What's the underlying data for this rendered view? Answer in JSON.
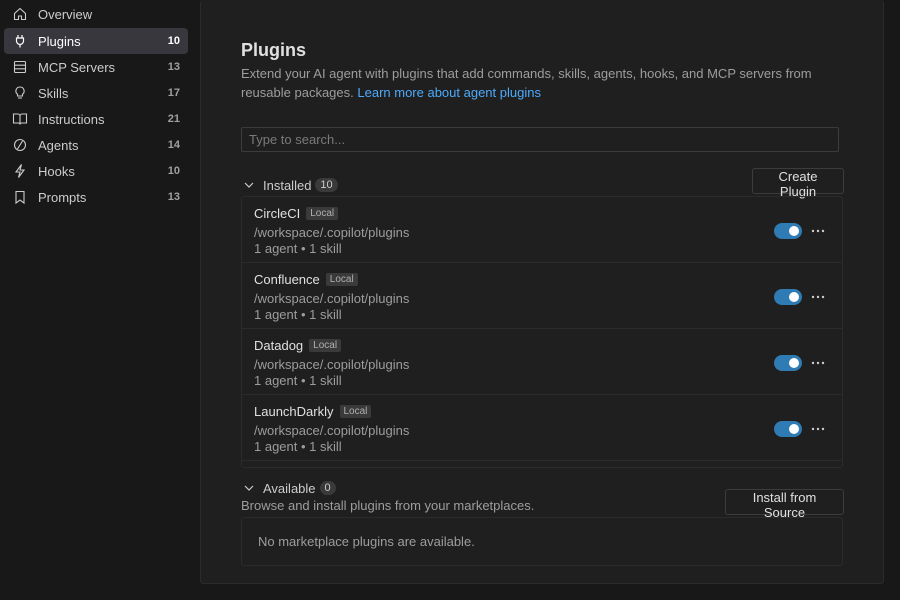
{
  "sidebar": {
    "items": [
      {
        "label": "Overview",
        "count": "",
        "icon": "home-icon"
      },
      {
        "label": "Plugins",
        "count": "10",
        "icon": "plug-icon"
      },
      {
        "label": "MCP Servers",
        "count": "13",
        "icon": "server-icon"
      },
      {
        "label": "Skills",
        "count": "17",
        "icon": "lightbulb-icon"
      },
      {
        "label": "Instructions",
        "count": "21",
        "icon": "book-icon"
      },
      {
        "label": "Agents",
        "count": "14",
        "icon": "agent-icon"
      },
      {
        "label": "Hooks",
        "count": "10",
        "icon": "lightning-icon"
      },
      {
        "label": "Prompts",
        "count": "13",
        "icon": "bookmark-icon"
      }
    ],
    "active_index": 1
  },
  "main": {
    "title": "Plugins",
    "description": "Extend your AI agent with plugins that add commands, skills, agents, hooks, and MCP servers from reusable packages.",
    "learn_more": "Learn more about agent plugins",
    "search_placeholder": "Type to search...",
    "installed": {
      "title": "Installed",
      "count": "10",
      "create_button": "Create Plugin",
      "plugins": [
        {
          "name": "CircleCI",
          "tag": "Local",
          "path": "/workspace/.copilot/plugins",
          "meta": "1 agent • 1 skill",
          "enabled": true
        },
        {
          "name": "Confluence",
          "tag": "Local",
          "path": "/workspace/.copilot/plugins",
          "meta": "1 agent • 1 skill",
          "enabled": true
        },
        {
          "name": "Datadog",
          "tag": "Local",
          "path": "/workspace/.copilot/plugins",
          "meta": "1 agent • 1 skill",
          "enabled": true
        },
        {
          "name": "LaunchDarkly",
          "tag": "Local",
          "path": "/workspace/.copilot/plugins",
          "meta": "1 agent • 1 skill",
          "enabled": true
        }
      ]
    },
    "available": {
      "title": "Available",
      "count": "0",
      "install_button": "Install from Source",
      "description": "Browse and install plugins from your marketplaces.",
      "empty_message": "No marketplace plugins are available."
    }
  },
  "colors": {
    "accent": "#2f7bb3",
    "link": "#4daafc",
    "background": "#181818"
  }
}
